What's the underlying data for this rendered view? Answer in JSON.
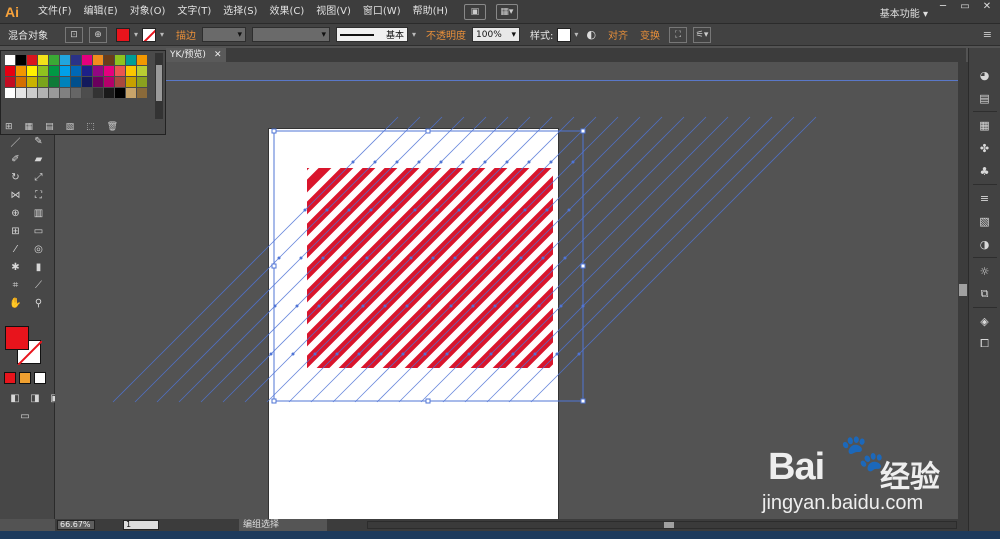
{
  "app": {
    "logo": "Ai",
    "workspace": "基本功能 ▾",
    "window_buttons": [
      "─",
      "▭",
      "✕"
    ]
  },
  "menu": [
    "文件(F)",
    "编辑(E)",
    "对象(O)",
    "文字(T)",
    "选择(S)",
    "效果(C)",
    "视图(V)",
    "窗口(W)",
    "帮助(H)"
  ],
  "control": {
    "object_type": "混合对象",
    "stroke_label": "描边",
    "stroke_style": "基本",
    "opacity_label": "不透明度",
    "opacity_value": "100%",
    "style_label": "样式:",
    "align_label": "对齐",
    "transform_label": "变换",
    "fill_color": "#e8141c"
  },
  "document_tab": {
    "title": "YK/预览)",
    "close": "✕"
  },
  "artwork": {
    "stripe_color": "#d9152c",
    "background_color": "#ffffff",
    "selection_color": "#4f74d6"
  },
  "status": {
    "zoom": "66.67%",
    "page": "1",
    "tool_status": "编组选择"
  },
  "swatch_colors": [
    [
      "#ffffff",
      "#000000",
      "#d9151e",
      "#f3e21a",
      "#3aa935",
      "#21a6df",
      "#2a3287",
      "#e5007e",
      "#f18d1d",
      "#6a3d1b",
      "#8ec31f",
      "#009e96",
      "#f39800"
    ],
    [
      "#e60012",
      "#f29600",
      "#fff100",
      "#8fc31f",
      "#009944",
      "#00a0e9",
      "#0068b7",
      "#1d2088",
      "#920783",
      "#e4007f",
      "#ea5550",
      "#fbc600",
      "#b9cd32"
    ],
    [
      "#c30d23",
      "#d46f00",
      "#cab300",
      "#7aa41c",
      "#0f7a38",
      "#0082bb",
      "#004f8c",
      "#131a5c",
      "#6a005d",
      "#b4006a",
      "#a9483e",
      "#c6a000",
      "#8aa11f"
    ],
    [
      "#ffffff",
      "#e5e5e5",
      "#cccccc",
      "#b3b3b3",
      "#999999",
      "#808080",
      "#666666",
      "#4d4d4d",
      "#333333",
      "#1a1a1a",
      "#000000",
      "#c8a46a",
      "#8a6a3a"
    ]
  ],
  "swatch_footer": [
    "⊞",
    "▦",
    "▤",
    "▧",
    "⬚",
    "🗑"
  ]
}
